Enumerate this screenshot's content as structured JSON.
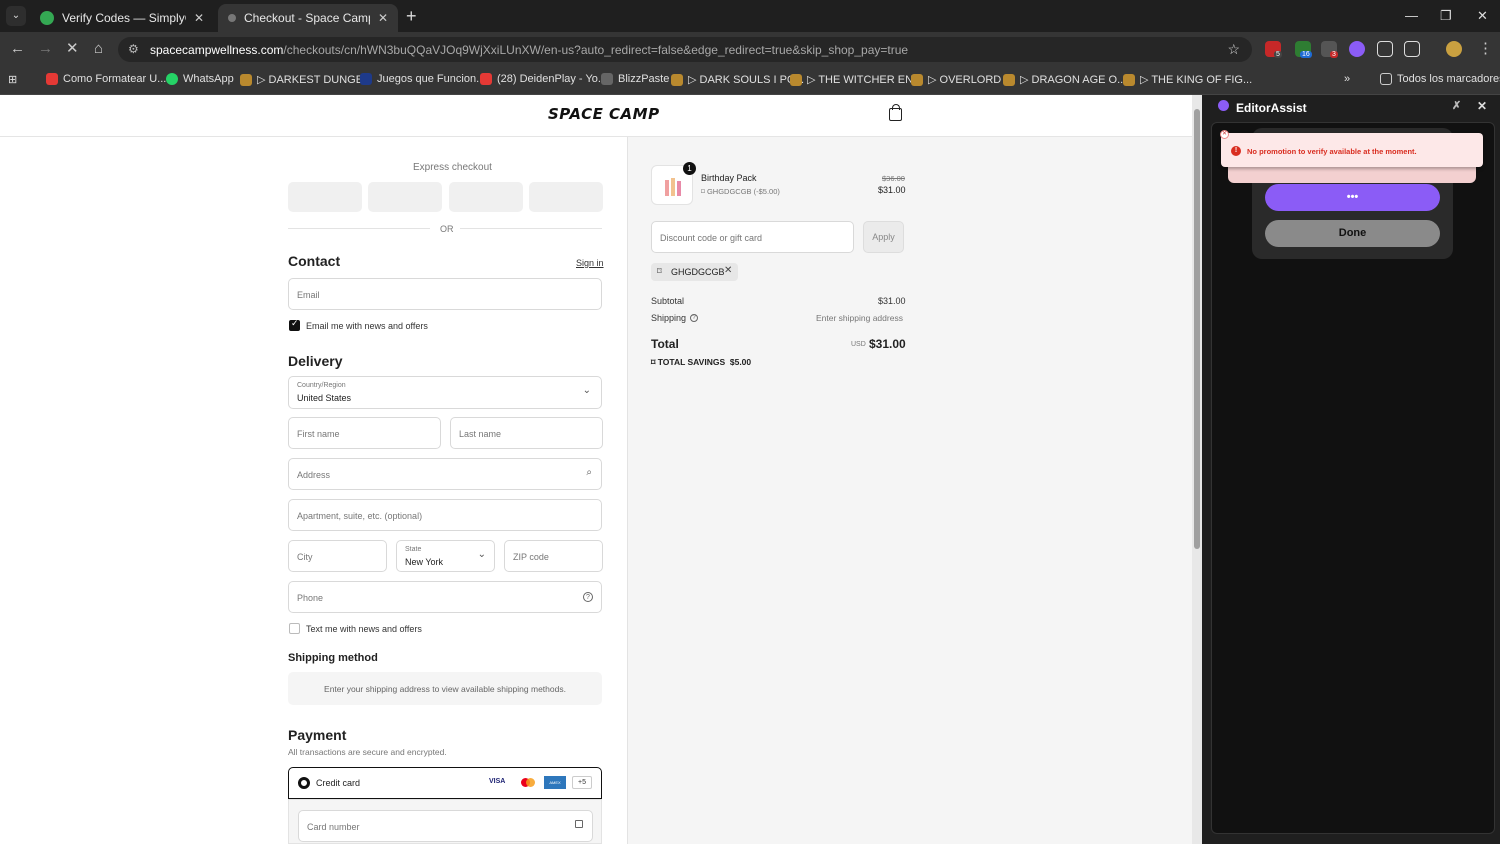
{
  "browser": {
    "tabs": [
      {
        "title": "Verify Codes — SimplyCodes",
        "active": false
      },
      {
        "title": "Checkout - Space Camp Wellness",
        "active": true
      }
    ],
    "url_host": "spacecampwellness.com",
    "url_path": "/checkouts/cn/hWN3buQQaVJOq9WjXxiLUnXW/en-us?auto_redirect=false&edge_redirect=true&skip_shop_pay=true",
    "extension_badges": [
      "5",
      "16",
      "3"
    ],
    "bookmarks": [
      "Como Formatear U...",
      "WhatsApp",
      "▷ DARKEST DUNGE...",
      "Juegos que Funcion...",
      "(28) DeidenPlay - Yo...",
      "BlizzPaste",
      "▷ DARK SOULS I PC...",
      "▷ THE WITCHER EN...",
      "▷ OVERLORD I",
      "▷ DRAGON AGE O...",
      "▷ THE KING OF FIG..."
    ],
    "bookmarks_more": "»",
    "all_bookmarks": "Todos los marcadores"
  },
  "store": {
    "logo": "SPACE CAMP"
  },
  "checkout": {
    "express_label": "Express checkout",
    "or_label": "OR",
    "contact_title": "Contact",
    "sign_in": "Sign in",
    "email_placeholder": "Email",
    "email_opt_in": "Email me with news and offers",
    "delivery_title": "Delivery",
    "country_label": "Country/Region",
    "country_value": "United States",
    "first_name": "First name",
    "last_name": "Last name",
    "address": "Address",
    "apartment": "Apartment, suite, etc. (optional)",
    "city": "City",
    "state_label": "State",
    "state_value": "New York",
    "zip": "ZIP code",
    "phone": "Phone",
    "text_opt_in": "Text me with news and offers",
    "shipping_method_title": "Shipping method",
    "shipping_method_msg": "Enter your shipping address to view available shipping methods.",
    "payment_title": "Payment",
    "payment_sub": "All transactions are secure and encrypted.",
    "credit_card": "Credit card",
    "card_brands": [
      "VISA",
      "MC",
      "AMEX"
    ],
    "card_more": "+5",
    "card_number": "Card number"
  },
  "summary": {
    "qty": "1",
    "product_name": "Birthday Pack",
    "product_discount": "GHGDGCGB (-$5.00)",
    "original_price": "$36.00",
    "price": "$31.00",
    "discount_placeholder": "Discount code or gift card",
    "apply": "Apply",
    "applied_code": "GHGDGCGB",
    "subtotal_label": "Subtotal",
    "subtotal_value": "$31.00",
    "shipping_label": "Shipping",
    "shipping_value": "Enter shipping address",
    "total_label": "Total",
    "currency": "USD",
    "total_value": "$31.00",
    "savings_label": "TOTAL SAVINGS",
    "savings_value": "$5.00"
  },
  "panel": {
    "title": "EditorAssist",
    "toast": "No promotion to verify available at the moment.",
    "busy_button": "•••",
    "done": "Done"
  },
  "colors": {
    "accent_purple": "#8b5cf6",
    "error_red": "#d92d20",
    "panel_bg": "#111111"
  }
}
